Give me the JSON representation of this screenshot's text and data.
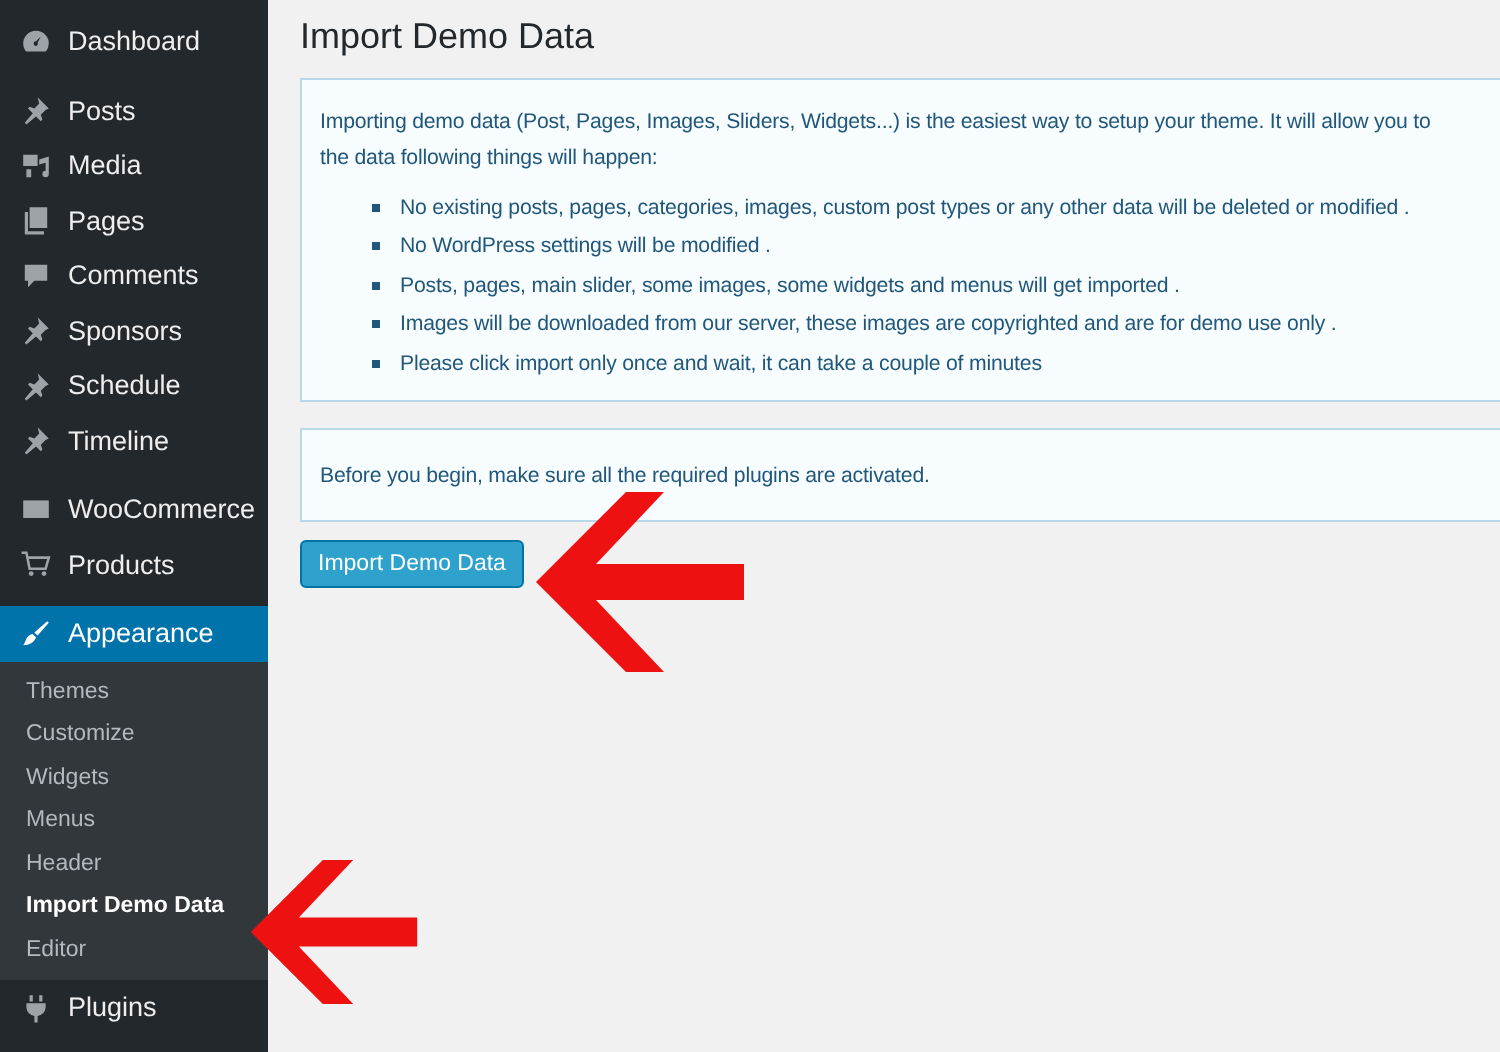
{
  "menu_groups": [
    [
      {
        "kind": "dashboard",
        "label": "Dashboard",
        "selected": false
      }
    ],
    [
      {
        "kind": "pin",
        "label": "Posts",
        "selected": false
      },
      {
        "kind": "media",
        "label": "Media",
        "selected": false
      },
      {
        "kind": "pages",
        "label": "Pages",
        "selected": false
      },
      {
        "kind": "comments",
        "label": "Comments",
        "selected": false
      },
      {
        "kind": "pin",
        "label": "Sponsors",
        "selected": false
      },
      {
        "kind": "pin",
        "label": "Schedule",
        "selected": false
      },
      {
        "kind": "pin",
        "label": "Timeline",
        "selected": false
      }
    ],
    [
      {
        "kind": "woo",
        "label": "WooCommerce",
        "selected": false
      },
      {
        "kind": "cart",
        "label": "Products",
        "selected": false
      }
    ],
    [
      {
        "kind": "brush",
        "label": "Appearance",
        "selected": true,
        "children": [
          {
            "label": "Themes",
            "selected": false
          },
          {
            "label": "Customize",
            "selected": false
          },
          {
            "label": "Widgets",
            "selected": false
          },
          {
            "label": "Menus",
            "selected": false
          },
          {
            "label": "Header",
            "selected": false
          },
          {
            "label": "Import Demo Data",
            "selected": true
          },
          {
            "label": "Editor",
            "selected": false
          }
        ]
      },
      {
        "kind": "plug",
        "label": "Plugins",
        "selected": false
      }
    ]
  ],
  "page_title": "Import Demo Data",
  "intro_lines": [
    "Importing demo data (Post, Pages, Images, Sliders, Widgets...) is the easiest way to setup your theme. It will allow you to",
    "the data following things will happen:"
  ],
  "bullets": [
    "No existing posts, pages, categories, images, custom post types or any other data will be deleted or modified .",
    "No WordPress settings will be modified .",
    "Posts, pages, main slider, some images, some widgets and menus will get imported .",
    "Images will be downloaded from our server, these images are copyrighted and are for demo use only .",
    "Please click import only once and wait, it can take a couple of minutes"
  ],
  "notice": "Before you begin, make sure all the required plugins are activated.",
  "button": "Import Demo Data"
}
